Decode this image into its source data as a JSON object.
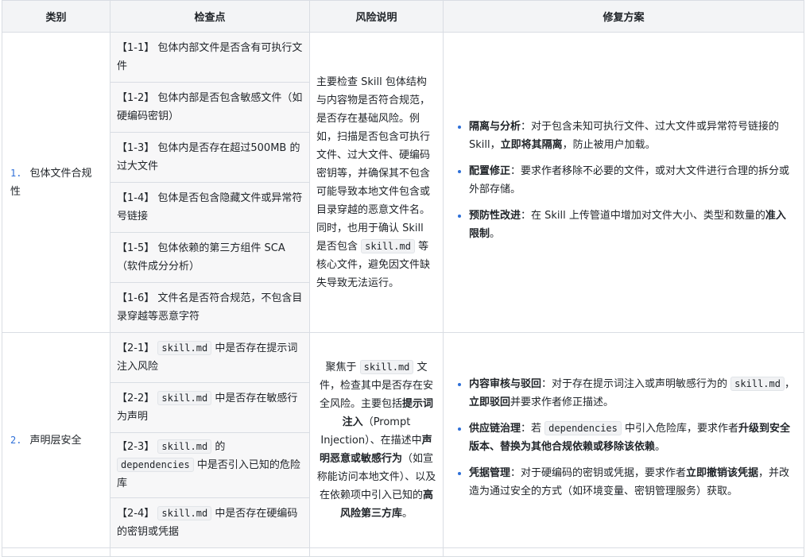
{
  "headers": {
    "category": "类别",
    "checkpoint": "检查点",
    "risk": "风险说明",
    "fix": "修复方案"
  },
  "section1": {
    "number": "1.",
    "category": "包体文件合规性",
    "checks": [
      {
        "id": "【1-1】",
        "text": "包体内部文件是否含有可执行文件"
      },
      {
        "id": "【1-2】",
        "text": "包体内部是否包含敏感文件（如硬编码密钥）"
      },
      {
        "id": "【1-3】",
        "text": "包体内是否存在超过500MB 的过大文件"
      },
      {
        "id": "【1-4】",
        "text": "包体是否包含隐藏文件或异常符号链接"
      },
      {
        "id": "【1-5】",
        "text": "包体依赖的第三方组件 SCA（软件成分分析）"
      },
      {
        "id": "【1-6】",
        "text": "文件名是否符合规范，不包含目录穿越等恶意字符"
      }
    ],
    "risk_a": "主要检查 Skill 包体结构与内容物是否符合规范，是否存在基础风险。例如，扫描是否包含可执行文件、过大文件、硬编码密钥等，并确保其不包含可能导致本地文件包含或目录穿越的恶意文件名。同时，也用于确认 Skill 是否包含",
    "risk_code": "skill.md",
    "risk_b": "等核心文件，避免因文件缺失导致无法运行。",
    "fixes": [
      {
        "title": "隔离与分析",
        "pre": "：对于包含未知可执行文件、过大文件或异常符号链接的 Skill，",
        "bold": "立即将其隔离",
        "post": "，防止被用户加载。"
      },
      {
        "title": "配置修正",
        "pre": "：要求作者移除不必要的文件，或对大文件进行合理的拆分或外部存储。",
        "bold": "",
        "post": ""
      },
      {
        "title": "预防性改进",
        "pre": "：在 Skill 上传管道中增加对文件大小、类型和数量的",
        "bold": "准入限制",
        "post": "。"
      }
    ]
  },
  "section2": {
    "number": "2.",
    "category": "声明层安全",
    "checks": [
      {
        "id": "【2-1】",
        "code": "skill.md",
        "text": "中是否存在提示词注入风险"
      },
      {
        "id": "【2-2】",
        "code": "skill.md",
        "text": "中是否存在敏感行为声明"
      },
      {
        "id": "【2-3】",
        "code": "skill.md",
        "mid": "的",
        "code2": "dependencies",
        "text": "中是否引入已知的危险库"
      },
      {
        "id": "【2-4】",
        "code": "skill.md",
        "text": "中是否存在硬编码的密钥或凭据"
      }
    ],
    "risk": {
      "p1": "聚焦于",
      "code": "skill.md",
      "p2": "文件，检查其中是否存在安全风险。主要包括",
      "b1": "提示词注入",
      "p3": "（Prompt Injection）、在描述中",
      "b2": "声明恶意或敏感行为",
      "p4": "（如宣称能访问本地文件）、以及在依赖项中引入已知的",
      "b3": "高风险第三方库",
      "p5": "。"
    },
    "fixes": {
      "f1": {
        "title": "内容审核与驳回",
        "pre": "：对于存在提示词注入或声明敏感行为的",
        "code": "skill.md",
        "mid": "，",
        "bold": "立即驳回",
        "post": "并要求作者修正描述。"
      },
      "f2": {
        "title": "供应链治理",
        "pre": "：若",
        "code": "dependencies",
        "mid": "中引入危险库，要求作者",
        "bold": "升级到安全版本、替换为其他合规依赖或移除该依赖",
        "post": "。"
      },
      "f3": {
        "title": "凭据管理",
        "pre": "：对于硬编码的密钥或凭据，要求作者",
        "bold": "立即撤销该凭据",
        "post": "，并改造为通过安全的方式（如环境变量、密钥管理服务）获取。"
      }
    }
  }
}
